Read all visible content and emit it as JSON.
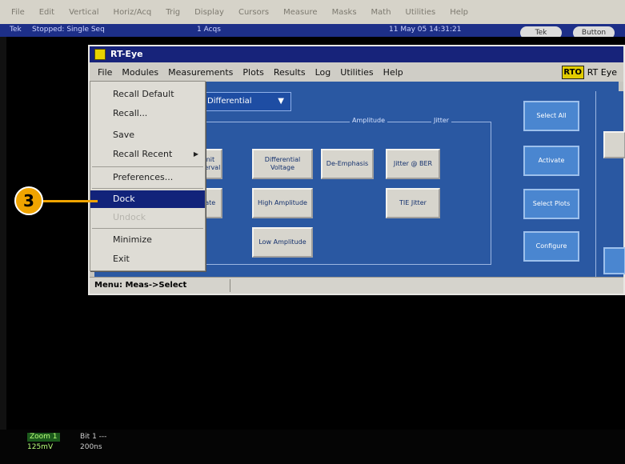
{
  "scope": {
    "menu": [
      "File",
      "Edit",
      "Vertical",
      "Horiz/Acq",
      "Trig",
      "Display",
      "Cursors",
      "Measure",
      "Masks",
      "Math",
      "Utilities",
      "Help"
    ],
    "status": {
      "mode": "Tek",
      "state": "Stopped: Single Seq",
      "acqs": "1 Acqs",
      "timestamp": "11 May 05 14:31:21"
    },
    "status_buttons": [
      "Tek",
      "Button"
    ],
    "readout": {
      "channel": "Zoom 1",
      "scale": "125mV",
      "zoom_label": "Bit 1 ---",
      "time": "200ns"
    }
  },
  "rt_window": {
    "title": "RT-Eye",
    "brand": "RT Eye",
    "brand_logo": "RTO",
    "menu": [
      "File",
      "Modules",
      "Measurements",
      "Plots",
      "Results",
      "Log",
      "Utilities",
      "Help"
    ],
    "differential_select": "Differential",
    "groups": {
      "amplitude": "Amplitude",
      "jitter": "Jitter"
    },
    "tiles": [
      {
        "label": "Differential Voltage",
        "name": "differential-voltage-tile"
      },
      {
        "label": "De-Emphasis",
        "name": "de-emphasis-tile"
      },
      {
        "label": "Jitter @ BER",
        "name": "jitter-ber-tile"
      },
      {
        "label": "High Amplitude",
        "name": "high-amplitude-tile"
      },
      {
        "label": "TIE Jitter",
        "name": "tie-jitter-tile"
      },
      {
        "label": "Low Amplitude",
        "name": "low-amplitude-tile"
      }
    ],
    "partial_tiles": [
      "Unit Interval",
      "Rate"
    ],
    "side_buttons": [
      "Select All",
      "Activate",
      "Select Plots",
      "Configure"
    ],
    "menu_hint": "Menu: Meas->Select"
  },
  "file_menu": {
    "items": [
      {
        "label": "Recall Default",
        "state": "normal"
      },
      {
        "label": "Recall...",
        "state": "normal"
      },
      {
        "label": "Save",
        "state": "normal"
      },
      {
        "label": "Recall Recent",
        "state": "submenu"
      },
      {
        "label": "Preferences...",
        "state": "normal"
      },
      {
        "label": "Dock",
        "state": "selected"
      },
      {
        "label": "Undock",
        "state": "disabled"
      },
      {
        "label": "Minimize",
        "state": "normal"
      },
      {
        "label": "Exit",
        "state": "normal"
      }
    ]
  },
  "callout": {
    "number": "3",
    "color": "#f0a400"
  },
  "colors": {
    "titlebar": "#17237a",
    "panel": "#2a58a2",
    "selection": "#12237a"
  }
}
